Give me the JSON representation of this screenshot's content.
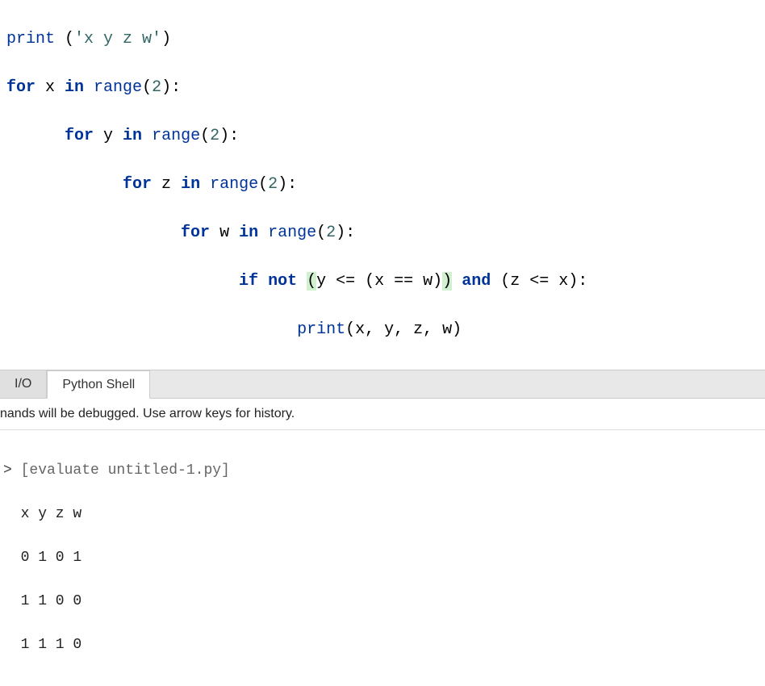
{
  "code": {
    "line1": {
      "fn": "print",
      "lparen": " (",
      "str": "'x y z w'",
      "rparen": ")"
    },
    "line2": {
      "kw": "for",
      "var": " x ",
      "kw2": "in",
      "fn": " range",
      "lparen": "(",
      "num": "2",
      "rparen": "):"
    },
    "line3": {
      "indent": "      ",
      "kw": "for",
      "var": " y ",
      "kw2": "in",
      "fn": " range",
      "lparen": "(",
      "num": "2",
      "rparen": "):"
    },
    "line4": {
      "indent": "            ",
      "kw": "for",
      "var": " z ",
      "kw2": "in",
      "fn": " range",
      "lparen": "(",
      "num": "2",
      "rparen": "):"
    },
    "line5": {
      "indent": "                  ",
      "kw": "for",
      "var": " w ",
      "kw2": "in",
      "fn": " range",
      "lparen": "(",
      "num": "2",
      "rparen": "):"
    },
    "line6": {
      "indent": "                        ",
      "kw": "if",
      "sp": " ",
      "kw2": "not",
      "sp2": " ",
      "hl1": "(",
      "expr": "y <= (x == w)",
      "hl2": ")",
      "sp3": " ",
      "kw3": "and",
      "rest": " (z <= x):"
    },
    "line7": {
      "indent": "                              ",
      "fn": "print",
      "args": "(x, y, z, w)"
    }
  },
  "tabs": {
    "io": "I/O",
    "shell": "Python Shell"
  },
  "shell_info": "nands will be debugged.  Use arrow keys for history.",
  "output": {
    "prompt": ">",
    "eval": " [evaluate untitled-1.py]",
    "header": "  x y z w",
    "rows": [
      "  0 1 0 1",
      "  1 1 0 0",
      "  1 1 1 0"
    ]
  }
}
